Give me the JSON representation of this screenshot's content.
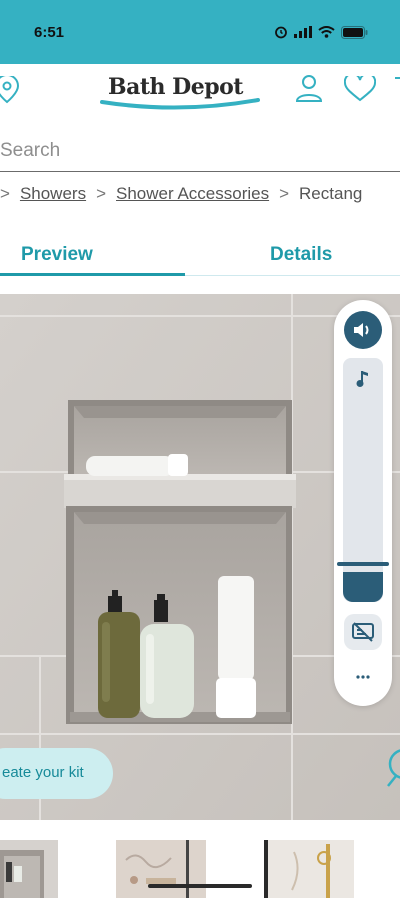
{
  "status_bar": {
    "time": "6:51"
  },
  "header": {
    "logo_text": "Bath Depot"
  },
  "search": {
    "placeholder": "Search"
  },
  "breadcrumb": {
    "separator": ">",
    "items": [
      "Showers",
      "Shower Accessories",
      "Rectang"
    ]
  },
  "tabs": [
    {
      "label": "Preview",
      "active": true
    },
    {
      "label": "Details",
      "active": false
    }
  ],
  "kit_button": {
    "label": "eate your kit"
  },
  "volume_panel": {
    "level": 0.05
  },
  "colors": {
    "brand": "#35b1c2",
    "accent": "#1f9aa9",
    "slider": "#2b5d78"
  }
}
